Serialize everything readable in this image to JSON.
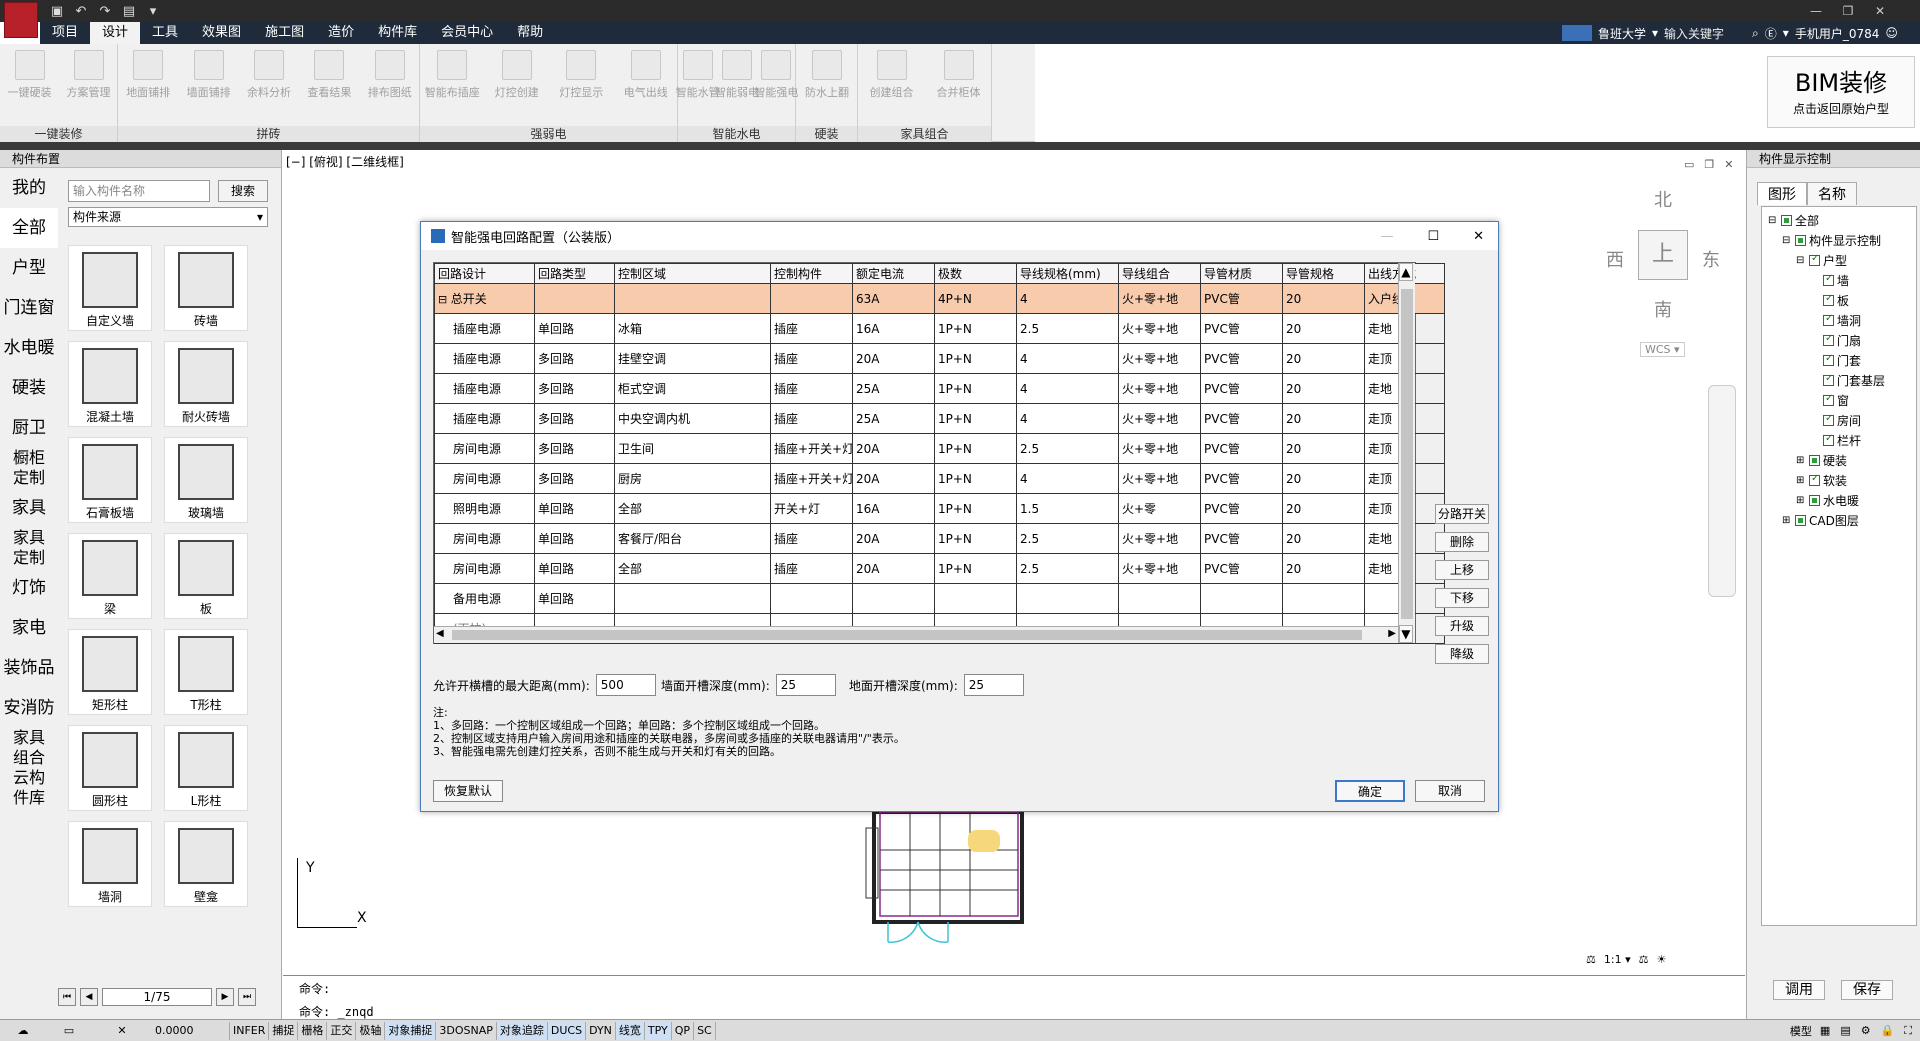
{
  "menu": {
    "tabs": [
      "项目",
      "设计",
      "工具",
      "效果图",
      "施工图",
      "造价",
      "构件库",
      "会员中心",
      "帮助"
    ],
    "active_index": 1
  },
  "top_right": {
    "school": "鲁班大学",
    "search_placeholder": "输入关键字",
    "user": "手机用户_0784"
  },
  "ribbon": {
    "groups": [
      {
        "label": "一键装修",
        "buttons": [
          "一键硬装",
          "方案管理"
        ]
      },
      {
        "label": "拼砖",
        "buttons": [
          "地面铺排",
          "墙面铺排",
          "余料分析",
          "查看结果",
          "排布图纸"
        ]
      },
      {
        "label": "强弱电",
        "buttons": [
          "智能布插座",
          "灯控创建",
          "灯控显示",
          "电气出线"
        ]
      },
      {
        "label": "智能水电",
        "buttons": [
          "智能水管",
          "智能弱电",
          "智能强电"
        ]
      },
      {
        "label": "硬装",
        "buttons": [
          "防水上翻"
        ]
      },
      {
        "label": "家具组合",
        "buttons": [
          "创建组合",
          "合并柜体"
        ]
      }
    ]
  },
  "bim": {
    "title": "BIM装修",
    "subtitle": "点击返回原始户型"
  },
  "left_panel": {
    "title": "构件布置",
    "categories": [
      "我的",
      "全部",
      "户型",
      "门连窗",
      "水电暖",
      "硬装",
      "厨卫",
      "橱柜定制",
      "家具",
      "家具定制",
      "灯饰",
      "家电",
      "装饰品",
      "安消防",
      "家具组合",
      "云构件库"
    ],
    "selected_index": 1,
    "search_placeholder": "输入构件名称",
    "search_button": "搜索",
    "source_select": "构件来源",
    "tiles": [
      "自定义墙",
      "砖墙",
      "混凝土墙",
      "耐火砖墙",
      "石膏板墙",
      "玻璃墙",
      "梁",
      "板",
      "矩形柱",
      "T形柱",
      "圆形柱",
      "L形柱",
      "墙洞",
      "壁龛"
    ],
    "page": "1/75"
  },
  "viewport": {
    "label": "[−] [俯视] [二维线框]",
    "compass": {
      "n": "北",
      "s": "南",
      "e": "东",
      "w": "西",
      "center": "上"
    },
    "wcs": "WCS ▾",
    "axis_y": "Y",
    "axis_x": "X"
  },
  "right_panel": {
    "title": "构件显示控制",
    "tabs": [
      "图形",
      "名称"
    ],
    "tree": [
      {
        "label": "全部",
        "level": 0,
        "exp": "⊟",
        "cb": "g"
      },
      {
        "label": "构件显示控制",
        "level": 1,
        "exp": "⊟",
        "cb": "g"
      },
      {
        "label": "户型",
        "level": 2,
        "exp": "⊟",
        "cb": "c"
      },
      {
        "label": "墙",
        "level": 3,
        "exp": "",
        "cb": "c"
      },
      {
        "label": "板",
        "level": 3,
        "exp": "",
        "cb": "c"
      },
      {
        "label": "墙洞",
        "level": 3,
        "exp": "",
        "cb": "c"
      },
      {
        "label": "门扇",
        "level": 3,
        "exp": "",
        "cb": "c"
      },
      {
        "label": "门套",
        "level": 3,
        "exp": "",
        "cb": "c"
      },
      {
        "label": "门套基层",
        "level": 3,
        "exp": "",
        "cb": "c"
      },
      {
        "label": "窗",
        "level": 3,
        "exp": "",
        "cb": "c"
      },
      {
        "label": "房间",
        "level": 3,
        "exp": "",
        "cb": "c"
      },
      {
        "label": "栏杆",
        "level": 3,
        "exp": "",
        "cb": "c"
      },
      {
        "label": "硬装",
        "level": 2,
        "exp": "⊞",
        "cb": "g"
      },
      {
        "label": "软装",
        "level": 2,
        "exp": "⊞",
        "cb": "c"
      },
      {
        "label": "水电暖",
        "level": 2,
        "exp": "⊞",
        "cb": "g"
      },
      {
        "label": "CAD图层",
        "level": 1,
        "exp": "⊞",
        "cb": "g"
      }
    ],
    "btn_apply": "调用",
    "btn_save": "保存"
  },
  "dialog": {
    "title": "智能强电回路配置（公装版）",
    "columns": [
      "回路设计",
      "回路类型",
      "控制区域",
      "控制构件",
      "额定电流",
      "极数",
      "导线规格(mm)",
      "导线组合",
      "导管材质",
      "导管规格",
      "出线方式"
    ],
    "rows": [
      [
        "总开关",
        "",
        "",
        "",
        "63A",
        "4P+N",
        "4",
        "火+零+地",
        "PVC管",
        "20",
        "入户线"
      ],
      [
        "插座电源",
        "单回路",
        "冰箱",
        "插座",
        "16A",
        "1P+N",
        "2.5",
        "火+零+地",
        "PVC管",
        "20",
        "走地"
      ],
      [
        "插座电源",
        "多回路",
        "挂壁空调",
        "插座",
        "20A",
        "1P+N",
        "4",
        "火+零+地",
        "PVC管",
        "20",
        "走顶"
      ],
      [
        "插座电源",
        "多回路",
        "柜式空调",
        "插座",
        "25A",
        "1P+N",
        "4",
        "火+零+地",
        "PVC管",
        "20",
        "走地"
      ],
      [
        "插座电源",
        "多回路",
        "中央空调内机",
        "插座",
        "25A",
        "1P+N",
        "4",
        "火+零+地",
        "PVC管",
        "20",
        "走顶"
      ],
      [
        "房间电源",
        "多回路",
        "卫生间",
        "插座+开关+灯",
        "20A",
        "1P+N",
        "2.5",
        "火+零+地",
        "PVC管",
        "20",
        "走顶"
      ],
      [
        "房间电源",
        "多回路",
        "厨房",
        "插座+开关+灯",
        "20A",
        "1P+N",
        "4",
        "火+零+地",
        "PVC管",
        "20",
        "走顶"
      ],
      [
        "照明电源",
        "单回路",
        "全部",
        "开关+灯",
        "16A",
        "1P+N",
        "1.5",
        "火+零",
        "PVC管",
        "20",
        "走顶"
      ],
      [
        "房间电源",
        "单回路",
        "客餐厅/阳台",
        "插座",
        "20A",
        "1P+N",
        "2.5",
        "火+零+地",
        "PVC管",
        "20",
        "走地"
      ],
      [
        "房间电源",
        "单回路",
        "全部",
        "插座",
        "20A",
        "1P+N",
        "2.5",
        "火+零+地",
        "PVC管",
        "20",
        "走地"
      ],
      [
        "备用电源",
        "单回路",
        "",
        "",
        "",
        "",
        "",
        "",
        "",
        "",
        ""
      ],
      [
        "(下拉)",
        "",
        "",
        "",
        "",
        "",
        "",
        "",
        "",
        "",
        ""
      ]
    ],
    "side_buttons": [
      "分路开关",
      "删除",
      "上移",
      "下移",
      "升级",
      "降级"
    ],
    "fields": [
      {
        "label": "允许开横槽的最大距离(mm):",
        "value": "500"
      },
      {
        "label": "墙面开槽深度(mm):",
        "value": "25"
      },
      {
        "label": "地面开槽深度(mm):",
        "value": "25"
      }
    ],
    "notes": [
      "注:",
      "1、多回路：一个控制区域组成一个回路；单回路：多个控制区域组成一个回路。",
      "2、控制区域支持用户输入房间用途和插座的关联电器，多房间或多插座的关联电器请用\"/\"表示。",
      "3、智能强电需先创建灯控关系，否则不能生成与开关和灯有关的回路。"
    ],
    "btn_restore": "恢复默认",
    "btn_ok": "确定",
    "btn_cancel": "取消"
  },
  "command": {
    "line1": "命令:",
    "line2": "命令: _znqd"
  },
  "status": {
    "coord": "0.0000",
    "toggles": [
      "INFER",
      "捕捉",
      "栅格",
      "正交",
      "极轴",
      "对象捕捉",
      "3DOSNAP",
      "对象追踪",
      "DUCS",
      "DYN",
      "线宽",
      "TPY",
      "QP",
      "SC"
    ],
    "on": [
      "对象捕捉",
      "对象追踪",
      "DUCS",
      "线宽",
      "TPY"
    ],
    "model": "模型",
    "scale": "1:1 ▾"
  }
}
